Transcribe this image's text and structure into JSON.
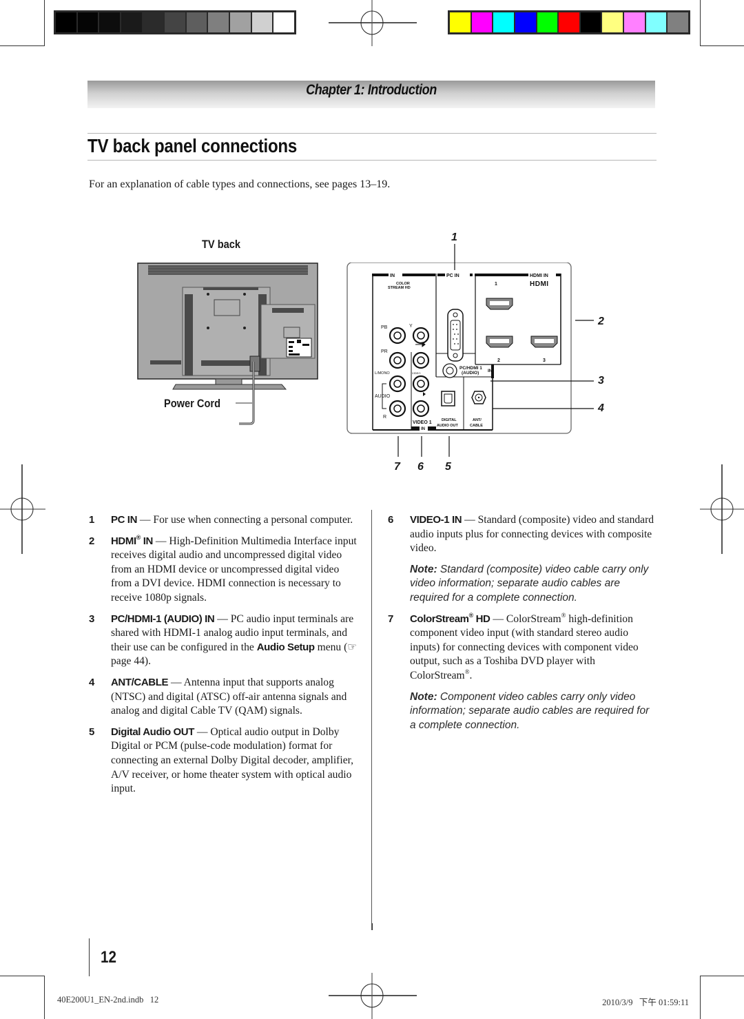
{
  "print_marks": {
    "grayscale_swatches": [
      "#000000",
      "#050505",
      "#0d0d0d",
      "#1a1a1a",
      "#2b2b2b",
      "#444444",
      "#5e5e5e",
      "#7f7f7f",
      "#a1a1a1",
      "#d0d0d0",
      "#ffffff"
    ],
    "color_swatches": [
      "#ffff00",
      "#ff00ff",
      "#00ffff",
      "#0000ff",
      "#00ff00",
      "#ff0000",
      "#000000",
      "#ffff80",
      "#ff80ff",
      "#80ffff",
      "#808080"
    ]
  },
  "header": {
    "chapter": "Chapter 1: Introduction",
    "title": "TV back panel connections",
    "intro": "For an explanation of cable types and connections, see pages 13–19."
  },
  "figure": {
    "tv_back_label": "TV back",
    "power_cord_label": "Power Cord",
    "panel": {
      "in_label": "IN",
      "colorstream_label_1": "COLOR",
      "colorstream_label_2": "STREAM HD",
      "pc_in_label": "PC IN",
      "hdmi_in_label": "HDMI IN",
      "hdmi_logo": "HDMI",
      "hdmi_port_1": "1",
      "hdmi_port_2": "2",
      "hdmi_port_3": "3",
      "pb_label": "PB",
      "y_label": "Y",
      "pr_label": "PR",
      "lmono_label": "L/MONO",
      "video_label": "VIDEO",
      "audio_label": "AUDIO",
      "r_label": "R",
      "pc_hdmi_audio_1": "PC/HDMI 1",
      "pc_hdmi_audio_2": "(AUDIO)",
      "pc_hdmi_in": "IN",
      "video1_label": "VIDEO 1",
      "video1_in": "IN",
      "digital_label": "DIGITAL",
      "audio_out_label": "AUDIO OUT",
      "ant_label": "ANT/",
      "cable_label": "CABLE"
    },
    "callouts": [
      "1",
      "2",
      "3",
      "4",
      "5",
      "6",
      "7"
    ]
  },
  "items_left": [
    {
      "num": "1",
      "term": "PC IN",
      "text": " — For use when connecting a personal computer."
    },
    {
      "num": "2",
      "term": "HDMI",
      "sup": "®",
      "term2": " IN",
      "text": " — High-Definition Multimedia Interface input receives digital audio and uncompressed digital video from an HDMI device or uncompressed digital video from a DVI device. HDMI connection is necessary to receive 1080p signals."
    },
    {
      "num": "3",
      "term": "PC/HDMI-1 (AUDIO) IN",
      "text": " — PC audio input terminals are shared with HDMI-1 analog audio input terminals, and their use can be configured in the ",
      "bold_inline": "Audio Setup",
      "text2": " menu (☞ page 44)."
    },
    {
      "num": "4",
      "term": "ANT/CABLE",
      "text": " — Antenna input that supports analog (NTSC) and digital (ATSC) off-air antenna signals and analog and digital Cable TV (QAM) signals."
    },
    {
      "num": "5",
      "term": "Digital Audio OUT",
      "text": " — Optical audio output in Dolby Digital or PCM (pulse-code modulation) format for connecting an external Dolby Digital decoder, amplifier, A/V receiver, or home theater system with optical audio input."
    }
  ],
  "items_right": [
    {
      "num": "6",
      "term": "VIDEO-1 IN",
      "text": " — Standard (composite) video and standard audio inputs plus for connecting devices with composite video.",
      "note_label": "Note:",
      "note": " Standard (composite) video cable carry only video information; separate audio cables are required for a complete connection."
    },
    {
      "num": "7",
      "term": "ColorStream",
      "sup": "®",
      "term2": " HD",
      "text": " — ColorStream",
      "sup2": "®",
      "text_b": " high-definition component video input (with standard stereo audio inputs) for connecting devices with component video output, such as a Toshiba DVD player with ColorStream",
      "sup3": "®",
      "text_c": ".",
      "note_label": "Note:",
      "note": " Component video cables carry only video information; separate audio cables are required for a complete connection."
    }
  ],
  "footer": {
    "page_number": "12",
    "file": "40E200U1_EN-2nd.indb   12",
    "timestamp": "2010/3/9   下午 01:59:11"
  }
}
